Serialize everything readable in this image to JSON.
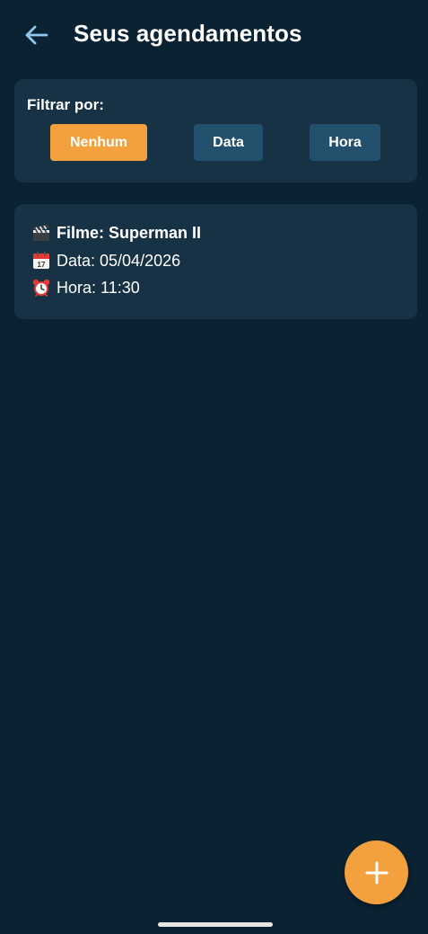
{
  "header": {
    "title": "Seus agendamentos",
    "back_icon": "arrow-left-icon"
  },
  "filter": {
    "label": "Filtrar por:",
    "options": [
      {
        "label": "Nenhum",
        "active": true
      },
      {
        "label": "Data",
        "active": false
      },
      {
        "label": "Hora",
        "active": false
      }
    ]
  },
  "appointments": [
    {
      "movie": "Filme: Superman II",
      "date": "Data: 05/04/2026",
      "time": "Hora: 11:30",
      "movie_icon": "clapperboard-icon",
      "date_icon": "calendar-icon",
      "time_icon": "alarm-clock-icon"
    }
  ],
  "fab": {
    "icon": "plus-icon"
  },
  "colors": {
    "background": "#0b2233",
    "card": "#163244",
    "accent": "#f2a13e",
    "inactive_button": "#23506d",
    "back_arrow": "#8fc7ee"
  }
}
